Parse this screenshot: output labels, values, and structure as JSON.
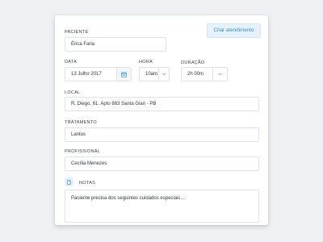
{
  "form": {
    "paciente": {
      "label": "PACIENTE",
      "value": "Érica Faria"
    },
    "create_button": "Criar atendimento",
    "data": {
      "label": "DATA",
      "value": "13 Julho 2017"
    },
    "hora": {
      "label": "HORA",
      "value": "10am"
    },
    "duracao": {
      "label": "DURAÇÃO",
      "value": "2h 00m"
    },
    "local": {
      "label": "LOCAL",
      "value": "R. Diego, 61. Apto 883 Santa Gian - PB"
    },
    "tratamento": {
      "label": "TRATAMENTO",
      "value": "Lantus"
    },
    "profissional": {
      "label": "PROFISSIONAL",
      "value": "Cecília Menezes"
    },
    "notas": {
      "label": "NOTAS",
      "value": "Paciente precisa dos seguintes cuidados especiais...."
    }
  },
  "colors": {
    "accent": "#2a8fd6",
    "accent_bg": "#e5f2fb",
    "border": "#dfe2e7",
    "background": "#eef0f3"
  },
  "icons": {
    "calendar": "calendar-icon",
    "chevron": "chevron-down-icon",
    "notes": "document-icon"
  }
}
